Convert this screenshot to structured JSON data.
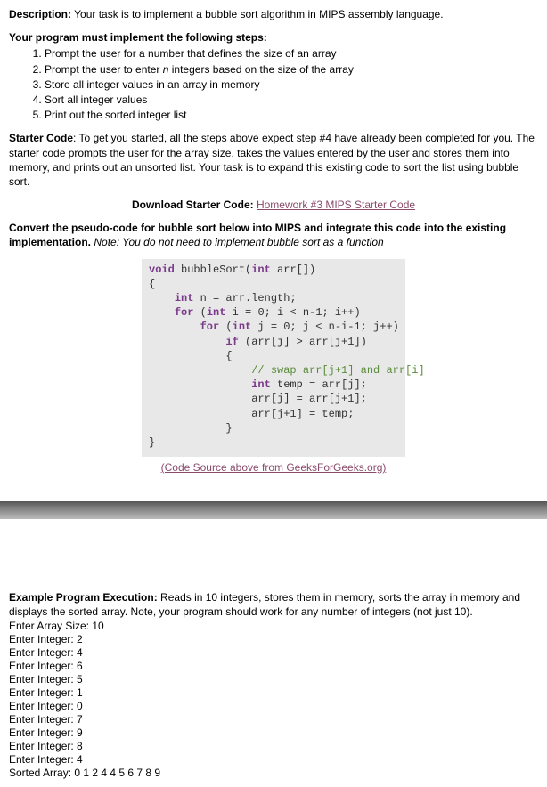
{
  "description": {
    "label": "Description:",
    "text": " Your task is to implement a bubble sort algorithm in MIPS assembly language."
  },
  "steps": {
    "heading": "Your program must implement the following steps:",
    "items": [
      "Prompt the user for a number that defines the size of an array",
      "Prompt the user to enter n integers based on the size of the array",
      "Store all integer values in an array in memory",
      "Sort all integer values",
      "Print out the sorted integer list"
    ],
    "item2_prefix": "Prompt the user to enter ",
    "item2_n": "n",
    "item2_suffix": " integers based on the size of the array"
  },
  "starter": {
    "label": "Starter Code",
    "text": ": To get you started, all the steps above expect step #4 have already been completed for you.  The starter code prompts the user for the array size, takes the values entered by the user and stores them into memory, and prints out an unsorted list.  Your task is to expand this existing code to sort the list using bubble sort."
  },
  "download": {
    "label": "Download Starter Code: ",
    "link": "Homework #3 MIPS Starter Code"
  },
  "convert": {
    "bold": "Convert the pseudo-code for bubble sort below into MIPS and integrate this code into the existing implementation.",
    "note_label": "  Note:",
    "note_text": " You do not need to implement bubble sort as a function"
  },
  "code": {
    "l1_void": "void",
    "l1_rest": " bubbleSort(",
    "l1_int": "int",
    "l1_tail": " arr[])",
    "l2": "{",
    "l3_int": "int",
    "l3_rest": " n = arr.length;",
    "l4_for": "for",
    "l4_open": " (",
    "l4_int": "int",
    "l4_rest": " i = 0; i < n-1; i++)",
    "l5_for": "for",
    "l5_open": " (",
    "l5_int": "int",
    "l5_rest": " j = 0; j < n-i-1; j++)",
    "l6_if": "if",
    "l6_rest": " (arr[j] > arr[j+1])",
    "l7": "{",
    "l8_cmt": "// swap arr[j+1] and arr[i]",
    "l9_int": "int",
    "l9_rest": " temp = arr[j];",
    "l10": "arr[j] = arr[j+1];",
    "l11": "arr[j+1] = temp;",
    "l12": "}",
    "l13": "}"
  },
  "code_source": {
    "text": "(Code Source above from GeeksForGeeks.org)"
  },
  "example": {
    "label": "Example Program Execution:",
    "text": "  Reads in 10 integers, stores them in memory, sorts the array in memory and displays the sorted array.  Note, your program should work for any number of integers (not just 10).",
    "lines": [
      "Enter Array Size: 10",
      "Enter Integer: 2",
      "Enter Integer: 4",
      "Enter Integer: 6",
      "Enter Integer: 5",
      "Enter Integer: 1",
      "Enter Integer: 0",
      "Enter Integer: 7",
      "Enter Integer: 9",
      "Enter Integer: 8",
      "Enter Integer: 4",
      "Sorted Array:  0 1 2 4 4 5 6 7 8 9"
    ]
  }
}
